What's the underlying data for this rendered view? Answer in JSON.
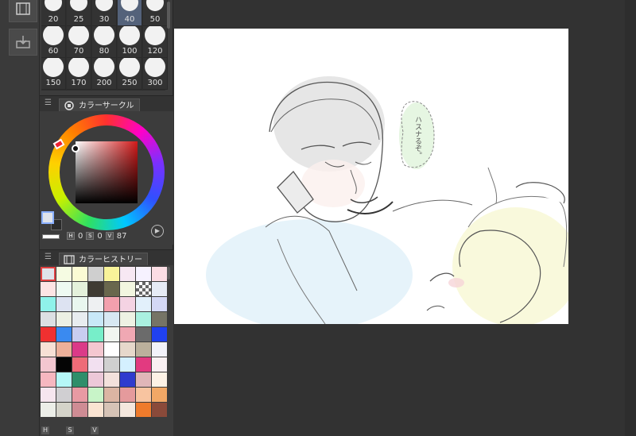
{
  "rail": {
    "buttons": [
      {
        "icon": "film-icon"
      },
      {
        "icon": "import-icon"
      }
    ]
  },
  "brush_sizes": {
    "items": [
      "20",
      "25",
      "30",
      "40",
      "50",
      "60",
      "70",
      "80",
      "100",
      "120",
      "150",
      "170",
      "200",
      "250",
      "300"
    ],
    "selected": "40"
  },
  "color_circle": {
    "tab_label": "カラーサークル",
    "hsv": {
      "h_label": "H",
      "h_value": "0",
      "s_label": "S",
      "s_value": "0",
      "v_label": "V",
      "v_value": "87"
    },
    "main_color": "#dfe3ea",
    "sub_color": "#2b2b2b"
  },
  "color_history": {
    "tab_label": "カラーヒストリー",
    "colors": [
      "#dfe3ea",
      "#f5fbe2",
      "#fbfbd4",
      "#cfcfcf",
      "#f8f39a",
      "#f7e8f3",
      "#f6f2ff",
      "#fbdde4",
      "#fde4e4",
      "#eefaf2",
      "#e4f1db",
      "#3f3b33",
      "#69674d",
      "#f2f6e0",
      "#checker",
      "#e6ebf5",
      "#8ff2ea",
      "#dde3f2",
      "#e9f7ef",
      "#eef0f2",
      "#f2a0ad",
      "#f4d3e3",
      "#e2f0fb",
      "#d4d8f5",
      "#dce0e3",
      "#ecf0e4",
      "#e8edf0",
      "#c8e8f8",
      "#d7e8f2",
      "#eef2e4",
      "#aaf1e0",
      "#767466",
      "#f03030",
      "#3a8af0",
      "#c9cdf0",
      "#77eec9",
      "#f1f5f0",
      "#f0a8b3",
      "#6b6b6b",
      "#2041f0",
      "#f7e0d5",
      "#ecb09a",
      "#db3a88",
      "#f4c7d0",
      "#ffffff",
      "#e6d8cb",
      "#bbb09c",
      "#f2f2fa",
      "#f3c7d0",
      "#050505",
      "#ee6b78",
      "#f2e0f0",
      "#d0d0d0",
      "#d4f0ff",
      "#e23a80",
      "#f9f0f2",
      "#f6b7c0",
      "#b5f7f7",
      "#2e8e6a",
      "#ecc8d8",
      "#f3e1dc",
      "#2f3bce",
      "#e0b6b8",
      "#fdf2e6",
      "#f6e6ef",
      "#d0cfd2",
      "#e89aa3",
      "#c8f4c8",
      "#dbb5a3",
      "#e59a9c",
      "#f8c4a0",
      "#f2a866",
      "#eceee8",
      "#d4d3c9",
      "#cf8c94",
      "#fae4d2",
      "#d6c3b6",
      "#f4e7dd",
      "#ef7b2c",
      "#8a4a3a"
    ]
  },
  "history_footer": {
    "h": "H",
    "s": "S",
    "v": "V"
  },
  "canvas_text": {
    "speech": "ハスナるぞ。"
  }
}
